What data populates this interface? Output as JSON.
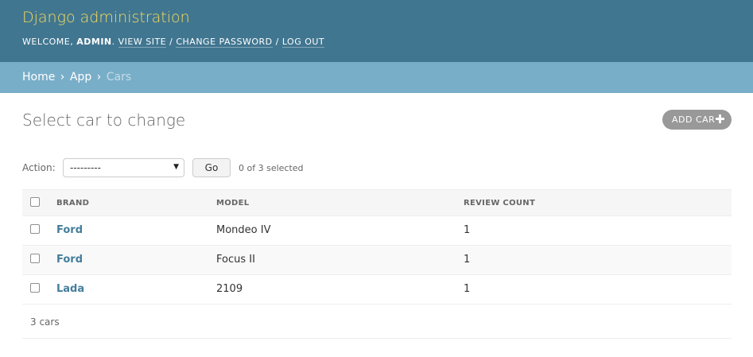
{
  "header": {
    "site_name": "Django administration",
    "welcome": "WELCOME,",
    "username": "ADMIN",
    "view_site": "VIEW SITE",
    "change_password": "CHANGE PASSWORD",
    "log_out": "LOG OUT",
    "separator": "/"
  },
  "breadcrumbs": {
    "home": "Home",
    "app": "App",
    "current": "Cars",
    "separator": "›"
  },
  "main": {
    "title": "Select car to change",
    "add_button": "ADD CAR"
  },
  "actions": {
    "label": "Action:",
    "selected_value": "---------",
    "go_label": "Go",
    "selection_count": "0 of 3 selected"
  },
  "table": {
    "columns": [
      "BRAND",
      "MODEL",
      "REVIEW COUNT"
    ],
    "rows": [
      {
        "brand": "Ford",
        "model": "Mondeo IV",
        "review_count": "1"
      },
      {
        "brand": "Ford",
        "model": "Focus II",
        "review_count": "1"
      },
      {
        "brand": "Lada",
        "model": "2109",
        "review_count": "1"
      }
    ]
  },
  "paginator": {
    "text": "3 cars"
  },
  "colors": {
    "header_bg": "#417690",
    "branding": "#f5dd5d",
    "breadcrumbs_bg": "#79aec8",
    "link": "#447e9b",
    "add_button_bg": "#999999"
  }
}
